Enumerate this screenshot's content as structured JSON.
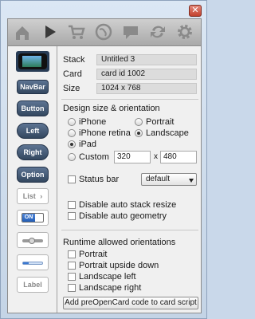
{
  "window": {
    "close_glyph": "✕"
  },
  "toolbar": {
    "icons": [
      "home-icon",
      "play-icon",
      "cart-icon",
      "globe-icon",
      "chat-icon",
      "sync-icon",
      "gear-icon"
    ],
    "active_index": 1
  },
  "palette": {
    "items": [
      "NavBar",
      "Button",
      "Left",
      "Right",
      "Option",
      "List",
      "ON",
      "Label"
    ],
    "list_arrow": "›",
    "slider_level": 0.45,
    "progress_level": 0.3
  },
  "card": {
    "stack_label": "Stack",
    "stack_value": "Untitled 3",
    "card_label": "Card",
    "card_value": "card id 1002",
    "size_label": "Size",
    "size_value": "1024 x 768"
  },
  "design": {
    "title": "Design size & orientation",
    "iphone": "iPhone",
    "iphone_retina": "iPhone retina",
    "ipad": "iPad",
    "custom": "Custom",
    "portrait": "Portrait",
    "landscape": "Landscape",
    "custom_w": "320",
    "custom_h": "480",
    "times": "x",
    "selected_device": "iPad",
    "selected_orientation": "Landscape"
  },
  "statusbar": {
    "label": "Status bar",
    "value": "default"
  },
  "options": {
    "disable_resize": "Disable auto stack resize",
    "disable_geometry": "Disable auto geometry"
  },
  "runtime": {
    "title": "Runtime allowed orientations",
    "items": [
      "Portrait",
      "Portrait upside down",
      "Landscape left",
      "Landscape right"
    ]
  },
  "action": {
    "label": "Add preOpenCard code to card script"
  }
}
